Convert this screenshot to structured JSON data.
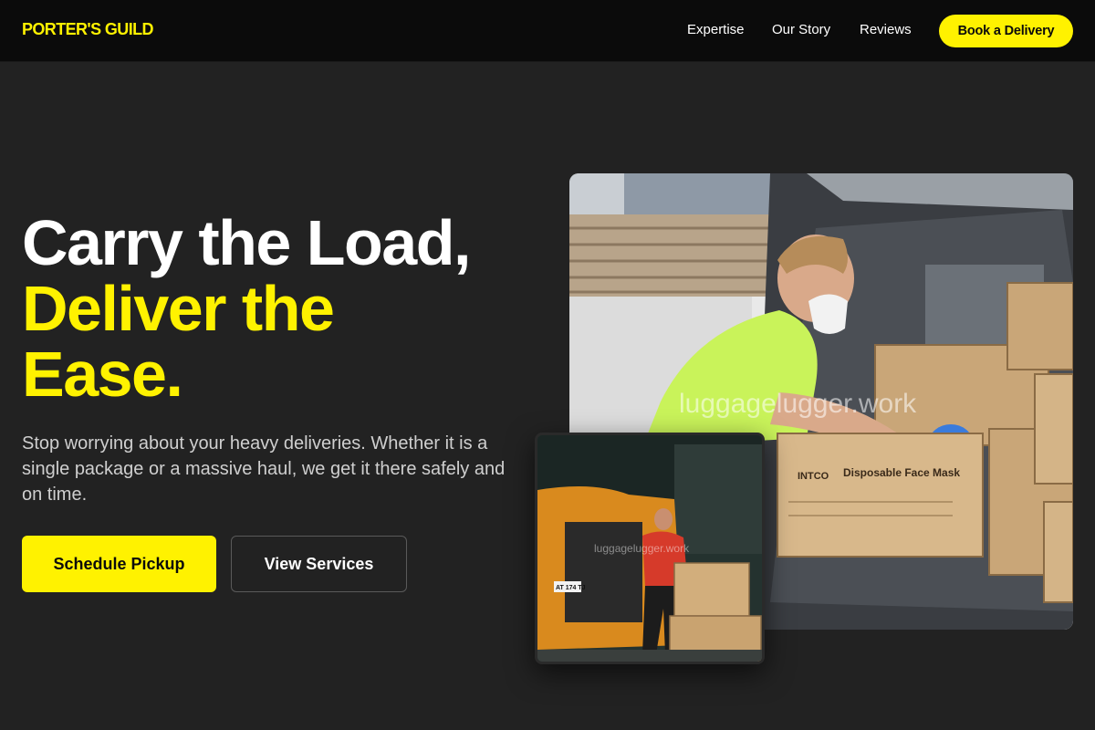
{
  "brand": {
    "name": "PORTER'S GUILD"
  },
  "nav": {
    "links": [
      "Expertise",
      "Our Story",
      "Reviews"
    ],
    "cta": "Book a Delivery"
  },
  "hero": {
    "title_line1": "Carry the Load,",
    "title_line2": "Deliver the",
    "title_line3": "Ease.",
    "description": "Stop worrying about your heavy deliveries. Whether it is a single package or a massive haul, we get it there safely and on time.",
    "primary_button": "Schedule Pickup",
    "secondary_button": "View Services"
  },
  "photos": {
    "main": {
      "box_label": "Disposable Face Mask",
      "box_brand": "INTCO",
      "watermark": "luggagelugger.work"
    },
    "small": {
      "watermark": "luggagelugger.work",
      "plate": "AT 174 TJ"
    }
  },
  "colors": {
    "accent": "#fff200",
    "background": "#222222",
    "navbar": "#0b0b0b"
  }
}
